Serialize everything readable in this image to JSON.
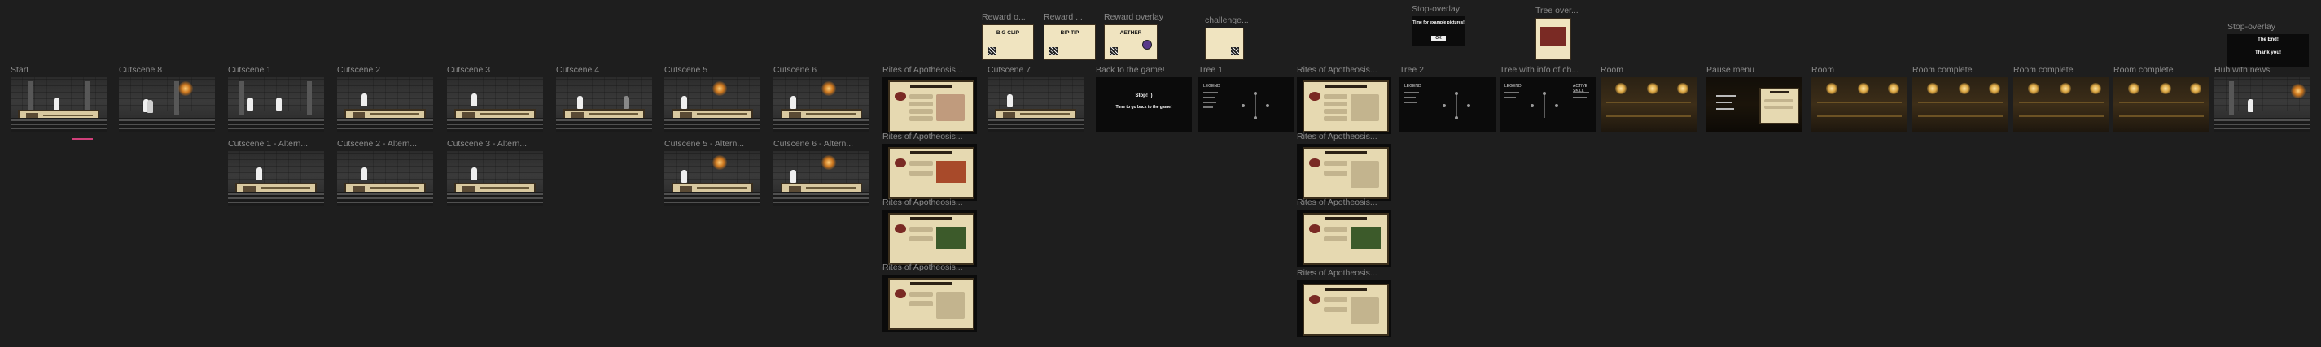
{
  "frames": {
    "start": "Start",
    "cutscene8": "Cutscene 8",
    "cutscene1": "Cutscene 1",
    "cutscene2": "Cutscene 2",
    "cutscene3": "Cutscene 3",
    "cutscene4": "Cutscene 4",
    "cutscene5": "Cutscene 5",
    "cutscene6": "Cutscene 6",
    "rites1": "Rites of Apotheosis...",
    "cutscene7": "Cutscene 7",
    "back_to_game": "Back to the game!",
    "tree1": "Tree 1",
    "rites_b1": "Rites of Apotheosis...",
    "tree2": "Tree 2",
    "tree_info": "Tree with info of ch...",
    "room1": "Room",
    "pause_menu": "Pause menu",
    "room2": "Room",
    "room_complete1": "Room complete",
    "room_complete2": "Room complete",
    "room_complete3": "Room complete",
    "hub_news": "Hub with news",
    "cutscene1_alt": "Cutscene 1 - Altern...",
    "cutscene2_alt": "Cutscene 2 - Altern...",
    "cutscene3_alt": "Cutscene 3 - Altern...",
    "cutscene5_alt": "Cutscene 5 - Altern...",
    "cutscene6_alt": "Cutscene 6 - Altern...",
    "rites2": "Rites of Apotheosis...",
    "rites3": "Rites of Apotheosis...",
    "rites4": "Rites of Apotheosis...",
    "rites_b2": "Rites of Apotheosis...",
    "rites_b3": "Rites of Apotheosis...",
    "rites_b4": "Rites of Apotheosis...",
    "reward1": "Reward o...",
    "reward2": "Reward ...",
    "reward3": "Reward overlay",
    "challenge": "challenge...",
    "stop_overlay1": "Stop-overlay",
    "tree_overlay": "Tree over...",
    "stop_overlay2": "Stop-overlay"
  },
  "overlays": {
    "reward1_title": "BIG CLIP",
    "reward2_title": "BIP TIP",
    "reward3_title": "AETHER",
    "back_to_game_l1": "Stop! :)",
    "back_to_game_l2": "Time to go back to the game!",
    "stop1_text": "Time for example pictures!",
    "stop1_button": "OK",
    "stop2_l1": "The End!",
    "stop2_l2": "Thank you!",
    "tree_legend": "LEGEND",
    "tree_info_title": "ACTIVE SKILL"
  },
  "colors": {
    "canvas": "#1e1e1e",
    "label": "#8a8a8a",
    "parchment": "#e6d9b1",
    "accent_pink": "#d0407a"
  }
}
